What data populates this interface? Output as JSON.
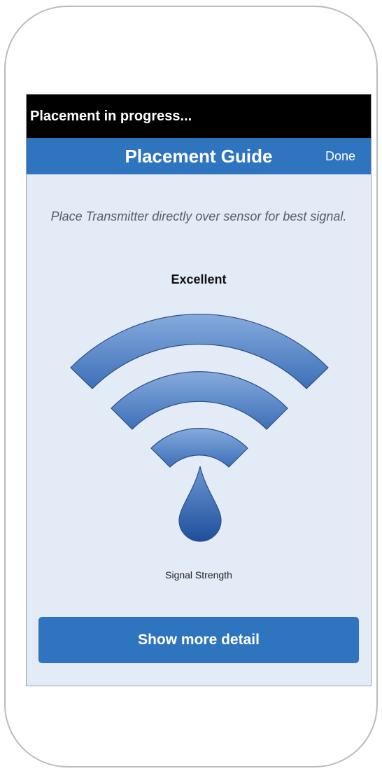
{
  "status_bar": {
    "text": "Placement in progress..."
  },
  "nav": {
    "title": "Placement Guide",
    "done_label": "Done"
  },
  "guide": {
    "instruction": "Place Transmitter directly over sensor for best signal.",
    "signal_level": "Excellent",
    "caption": "Signal Strength",
    "bars_active": 3,
    "bars_total": 3
  },
  "actions": {
    "more_detail_label": "Show more detail"
  },
  "colors": {
    "accent": "#2e74be",
    "screen_background": "#e3ebf6",
    "signal_light": "#7ea4d9",
    "signal_dark": "#2c61ad"
  },
  "icons": {
    "signal": "wifi-signal-icon",
    "sensor": "sensor-drop-icon"
  }
}
